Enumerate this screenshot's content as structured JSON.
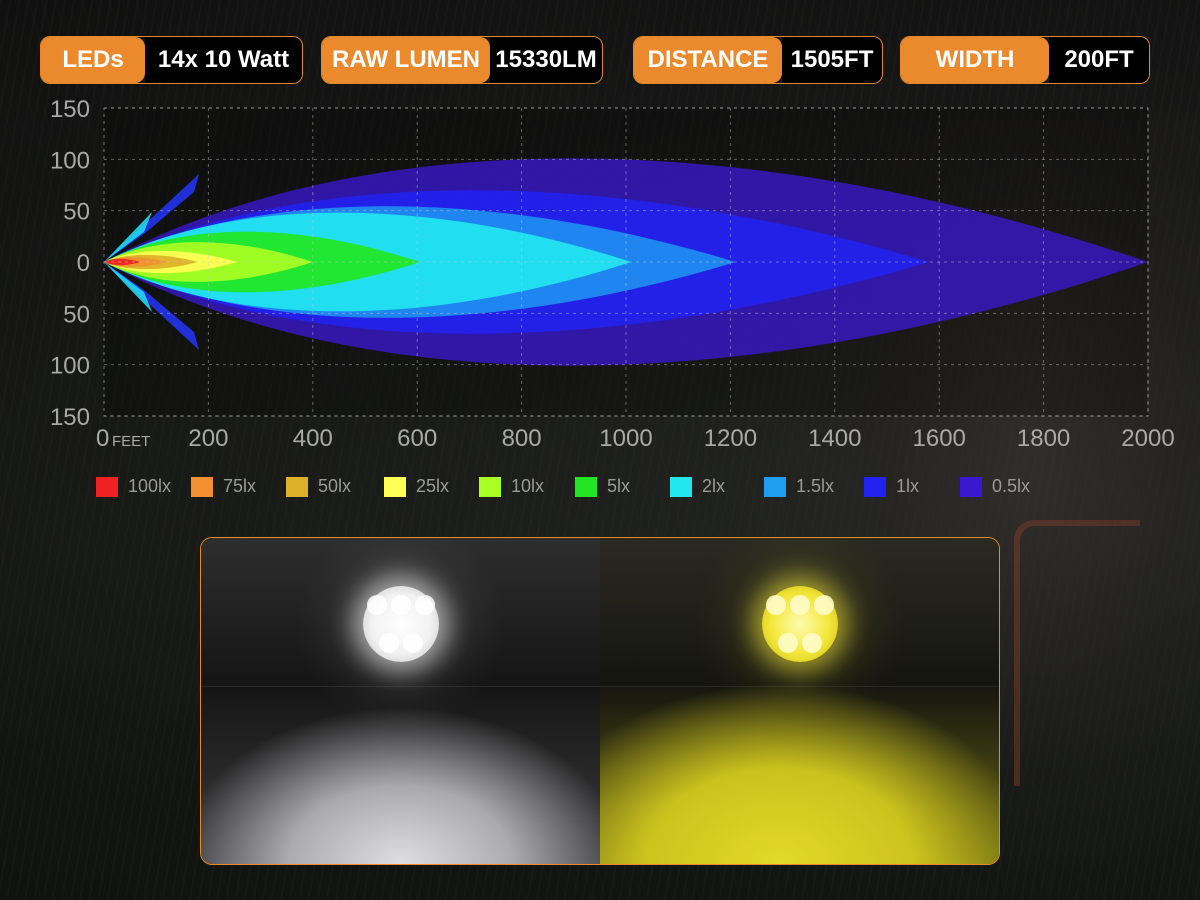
{
  "specs": {
    "leds": {
      "label": "LEDs",
      "value": "14x 10 Watt"
    },
    "raw_lumen": {
      "label": "RAW LUMEN",
      "value": "15330LM"
    },
    "distance": {
      "label": "DISTANCE",
      "value": "1505FT"
    },
    "width": {
      "label": "WIDTH",
      "value": "200FT"
    }
  },
  "chart_data": {
    "type": "area",
    "x_unit_label": "FEET",
    "x_ticks": [
      0,
      200,
      400,
      600,
      800,
      1000,
      1200,
      1400,
      1600,
      1800,
      2000
    ],
    "y_ticks": [
      "150",
      "100",
      "50",
      "0",
      "50",
      "100",
      "150"
    ],
    "xlim": [
      0,
      2000
    ],
    "ylim": [
      -150,
      150
    ],
    "grid": true,
    "legend_position": "bottom",
    "series": [
      {
        "name": "0.5lx",
        "color": "#3a18d0",
        "reach_ft": 2000,
        "half_width_ft": 130
      },
      {
        "name": "1lx",
        "color": "#2222ee",
        "reach_ft": 1580,
        "half_width_ft": 90
      },
      {
        "name": "1.5lx",
        "color": "#1f8ef0",
        "reach_ft": 1210,
        "half_width_ft": 70
      },
      {
        "name": "2lx",
        "color": "#22e6f0",
        "reach_ft": 1010,
        "half_width_ft": 62
      },
      {
        "name": "5lx",
        "color": "#22e622",
        "reach_ft": 605,
        "half_width_ft": 38
      },
      {
        "name": "10lx",
        "color": "#aaff22",
        "reach_ft": 400,
        "half_width_ft": 25
      },
      {
        "name": "25lx",
        "color": "#ffff55",
        "reach_ft": 255,
        "half_width_ft": 14
      },
      {
        "name": "50lx",
        "color": "#dcb028",
        "reach_ft": 180,
        "half_width_ft": 9
      },
      {
        "name": "75lx",
        "color": "#f09030",
        "reach_ft": 120,
        "half_width_ft": 6
      },
      {
        "name": "100lx",
        "color": "#ee2222",
        "reach_ft": 70,
        "half_width_ft": 4
      }
    ]
  },
  "legend": [
    {
      "label": "100lx",
      "color": "#ee2222"
    },
    {
      "label": "75lx",
      "color": "#f09030"
    },
    {
      "label": "50lx",
      "color": "#dcb028"
    },
    {
      "label": "25lx",
      "color": "#ffff55"
    },
    {
      "label": "10lx",
      "color": "#aaff22"
    },
    {
      "label": "5lx",
      "color": "#22e622"
    },
    {
      "label": "2lx",
      "color": "#22e6f0"
    },
    {
      "label": "1.5lx",
      "color": "#1f9ef0"
    },
    {
      "label": "1lx",
      "color": "#2222ee"
    },
    {
      "label": "0.5lx",
      "color": "#3a18d0"
    }
  ],
  "comparison": {
    "left": {
      "beam": "white"
    },
    "right": {
      "beam": "yellow"
    }
  }
}
